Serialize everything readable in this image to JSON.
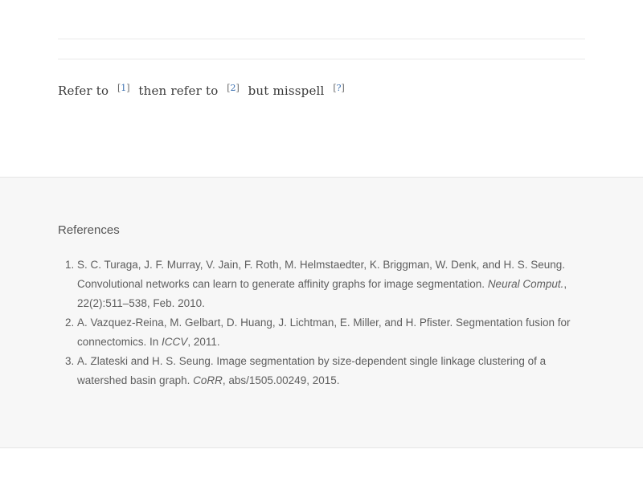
{
  "body_text": {
    "refer_to": "Refer to",
    "cite_1": "1",
    "then_refer_to": "then refer to",
    "cite_2": "2",
    "but_misspell": "but misspell",
    "cite_3": "?"
  },
  "references": {
    "title": "References",
    "items": [
      {
        "authors": "S. C. Turaga, J. F. Murray, V. Jain, F. Roth, M. Helmstaedter, K. Briggman, W. Denk, and H. S. Seung. Convolutional networks can learn to generate affinity graphs for image segmentation. ",
        "venue": "Neural Comput.",
        "details": ", 22(2):511–538, Feb. 2010."
      },
      {
        "authors": "A. Vazquez-Reina, M. Gelbart, D. Huang, J. Lichtman, E. Miller, and H. Pfister. Segmentation fusion for connectomics. In ",
        "venue": "ICCV",
        "details": ", 2011."
      },
      {
        "authors": "A. Zlateski and H. S. Seung. Image segmentation by size-dependent single linkage clustering of a watershed basin graph. ",
        "venue": "CoRR",
        "details": ", abs/1505.00249, 2015."
      }
    ]
  }
}
